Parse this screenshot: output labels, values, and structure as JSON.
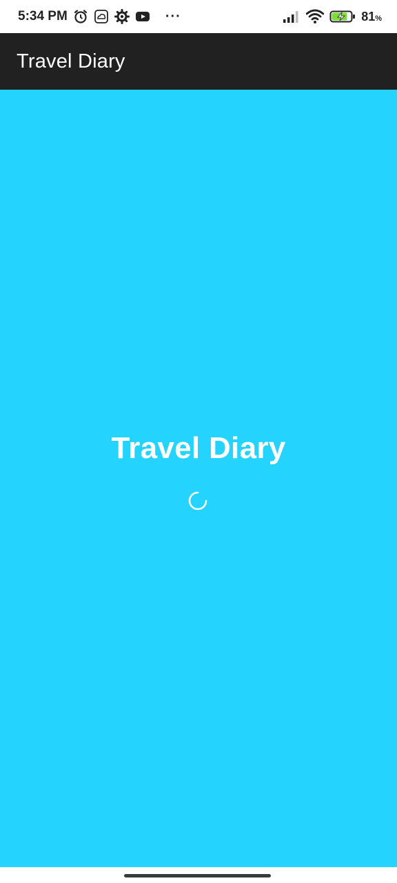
{
  "status_bar": {
    "time": "5:34 PM",
    "more_indicator": "···",
    "battery_percent": "81",
    "battery_percent_sign": "%",
    "battery_level": 0.81,
    "icons": [
      "alarm-icon",
      "cloud-icon",
      "settings-gear-icon",
      "youtube-icon",
      "signal-icon",
      "wifi-icon",
      "battery-charging-icon"
    ]
  },
  "app_bar": {
    "title": "Travel Diary"
  },
  "splash": {
    "title": "Travel Diary",
    "background_color": "#24d4ff",
    "spinner": "loading-spinner-icon"
  },
  "colors": {
    "app_bar": "#212121",
    "accent": "#24d4ff",
    "battery_fill": "#7bdc3a"
  }
}
